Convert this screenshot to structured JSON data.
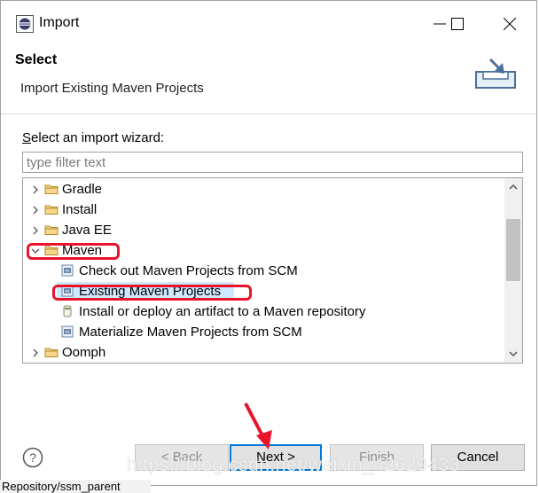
{
  "window": {
    "title": "Import"
  },
  "header": {
    "title": "Select",
    "subtitle": "Import Existing Maven Projects"
  },
  "wizard": {
    "label": "Select an import wizard:",
    "filter_placeholder": "type filter text",
    "tree": [
      {
        "label": "Gradle",
        "kind": "folder",
        "expanded": false
      },
      {
        "label": "Install",
        "kind": "folder",
        "expanded": false
      },
      {
        "label": "Java EE",
        "kind": "folder",
        "expanded": false
      },
      {
        "label": "Maven",
        "kind": "folder",
        "expanded": true
      },
      {
        "label": "Check out Maven Projects from SCM",
        "kind": "item"
      },
      {
        "label": "Existing Maven Projects",
        "kind": "item",
        "selected": true
      },
      {
        "label": "Install or deploy an artifact to a Maven repository",
        "kind": "item"
      },
      {
        "label": "Materialize Maven Projects from SCM",
        "kind": "item"
      },
      {
        "label": "Oomph",
        "kind": "folder",
        "expanded": false
      }
    ]
  },
  "buttons": {
    "back": "< Back",
    "next": "Next >",
    "finish": "Finish",
    "cancel": "Cancel"
  },
  "watermark": "https://blog.csdn.net/weixin_42629433",
  "background_text": "Repository/ssm_parent",
  "icons": {
    "app": "eclipse-icon",
    "wizard": "import-wizard-icon",
    "help": "help-icon"
  },
  "colors": {
    "selection": "#cde8ff",
    "annotation": "#e8142c",
    "default_button_border": "#0078d7"
  }
}
